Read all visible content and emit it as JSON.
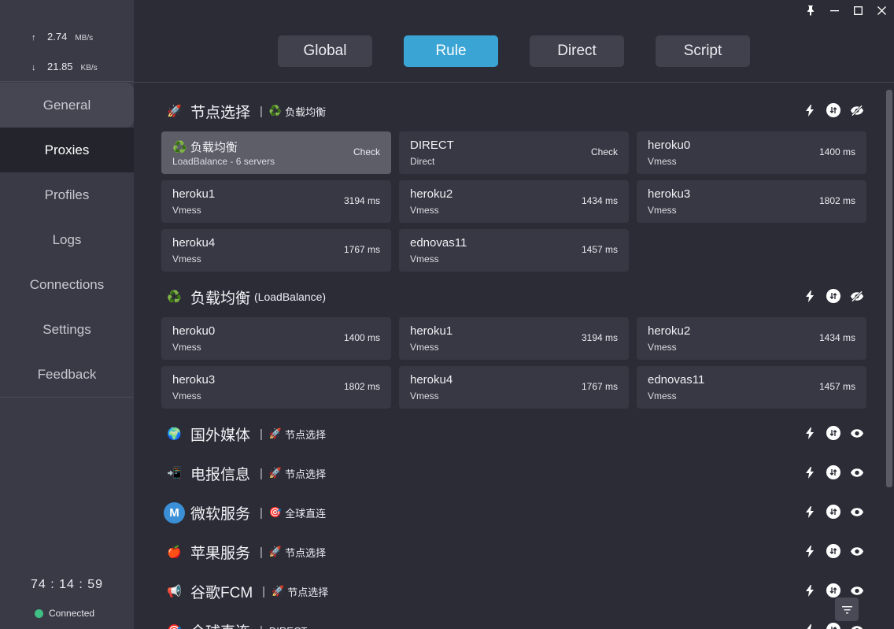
{
  "window": {
    "pin_icon": "pin-icon",
    "minimize_icon": "minimize-icon",
    "maximize_icon": "maximize-icon",
    "close_icon": "close-icon"
  },
  "sidebar": {
    "upload": {
      "arrow": "↑",
      "value": "2.74",
      "unit": "MB/s"
    },
    "download": {
      "arrow": "↓",
      "value": "21.85",
      "unit": "KB/s"
    },
    "items": [
      {
        "label": "General"
      },
      {
        "label": "Proxies"
      },
      {
        "label": "Profiles"
      },
      {
        "label": "Logs"
      },
      {
        "label": "Connections"
      },
      {
        "label": "Settings"
      },
      {
        "label": "Feedback"
      }
    ],
    "active": "Proxies",
    "uptime": "74 : 14 : 59",
    "status": "Connected",
    "status_color": "#3fbf84"
  },
  "modes": [
    {
      "label": "Global"
    },
    {
      "label": "Rule"
    },
    {
      "label": "Direct"
    },
    {
      "label": "Script"
    }
  ],
  "active_mode": "Rule",
  "accent_color": "#3aa5d4",
  "groups": [
    {
      "icon": "rocket-icon",
      "emoji": "🚀",
      "title": "节点选择",
      "now_icon": "♻️",
      "now": "负载均衡",
      "type": "",
      "visibility": "eye-off-icon",
      "proxies": [
        {
          "name": "♻️ 负载均衡",
          "type": "LoadBalance - 6 servers",
          "right": "Check",
          "selected": true
        },
        {
          "name": "DIRECT",
          "type": "Direct",
          "right": "Check"
        },
        {
          "name": "heroku0",
          "type": "Vmess",
          "right": "1400 ms"
        },
        {
          "name": "heroku1",
          "type": "Vmess",
          "right": "3194 ms"
        },
        {
          "name": "heroku2",
          "type": "Vmess",
          "right": "1434 ms"
        },
        {
          "name": "heroku3",
          "type": "Vmess",
          "right": "1802 ms"
        },
        {
          "name": "heroku4",
          "type": "Vmess",
          "right": "1767 ms"
        },
        {
          "name": "ednovas11",
          "type": "Vmess",
          "right": "1457 ms"
        }
      ]
    },
    {
      "icon": "recycle-icon",
      "emoji": "♻️",
      "title": "负载均衡",
      "now_icon": "",
      "now": "",
      "type": "(LoadBalance)",
      "visibility": "eye-off-icon",
      "proxies": [
        {
          "name": "heroku0",
          "type": "Vmess",
          "right": "1400 ms"
        },
        {
          "name": "heroku1",
          "type": "Vmess",
          "right": "3194 ms"
        },
        {
          "name": "heroku2",
          "type": "Vmess",
          "right": "1434 ms"
        },
        {
          "name": "heroku3",
          "type": "Vmess",
          "right": "1802 ms"
        },
        {
          "name": "heroku4",
          "type": "Vmess",
          "right": "1767 ms"
        },
        {
          "name": "ednovas11",
          "type": "Vmess",
          "right": "1457 ms"
        }
      ]
    },
    {
      "icon": "globe-icon",
      "emoji": "🌍",
      "title": "国外媒体",
      "now_icon": "🚀",
      "now": "节点选择",
      "type": "",
      "visibility": "eye-icon",
      "proxies": []
    },
    {
      "icon": "telegram-icon",
      "emoji": "📲",
      "title": "电报信息",
      "now_icon": "🚀",
      "now": "节点选择",
      "type": "",
      "visibility": "eye-icon",
      "proxies": []
    },
    {
      "icon": "microsoft-icon",
      "emoji": "M",
      "title": "微软服务",
      "now_icon": "🎯",
      "now": "全球直连",
      "type": "",
      "visibility": "eye-icon",
      "proxies": []
    },
    {
      "icon": "apple-icon",
      "emoji": "🍎",
      "title": "苹果服务",
      "now_icon": "🚀",
      "now": "节点选择",
      "type": "",
      "visibility": "eye-icon",
      "proxies": []
    },
    {
      "icon": "megaphone-icon",
      "emoji": "📢",
      "title": "谷歌FCM",
      "now_icon": "🚀",
      "now": "节点选择",
      "type": "",
      "visibility": "eye-icon",
      "proxies": []
    },
    {
      "icon": "target-icon",
      "emoji": "🎯",
      "title": "全球直连",
      "now_icon": "",
      "now": "DIRECT",
      "type": "",
      "visibility": "eye-icon",
      "proxies": []
    }
  ]
}
